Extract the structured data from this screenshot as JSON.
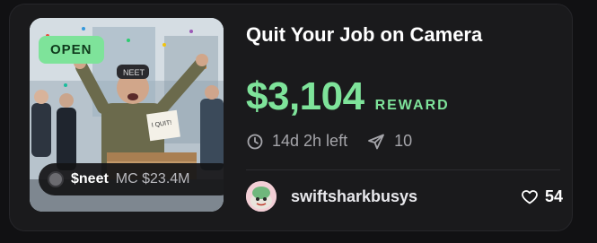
{
  "card": {
    "status_badge": "OPEN",
    "title": "Quit Your Job on Camera",
    "reward": {
      "amount": "$3,104",
      "label": "REWARD"
    },
    "time_left": "14d 2h left",
    "submissions_count": "10",
    "token": {
      "ticker": "$neet",
      "market_cap": "MC $23.4M"
    },
    "creator": {
      "username": "swiftsharkbusys"
    },
    "likes": "54"
  },
  "colors": {
    "accent": "#7ee39a",
    "background": "#1a1a1c",
    "muted_text": "#a5a5aa"
  },
  "icons": {
    "clock": "clock-icon",
    "send": "send-icon",
    "heart": "heart-icon",
    "token_logo": "token-logo-icon",
    "avatar": "avatar"
  }
}
